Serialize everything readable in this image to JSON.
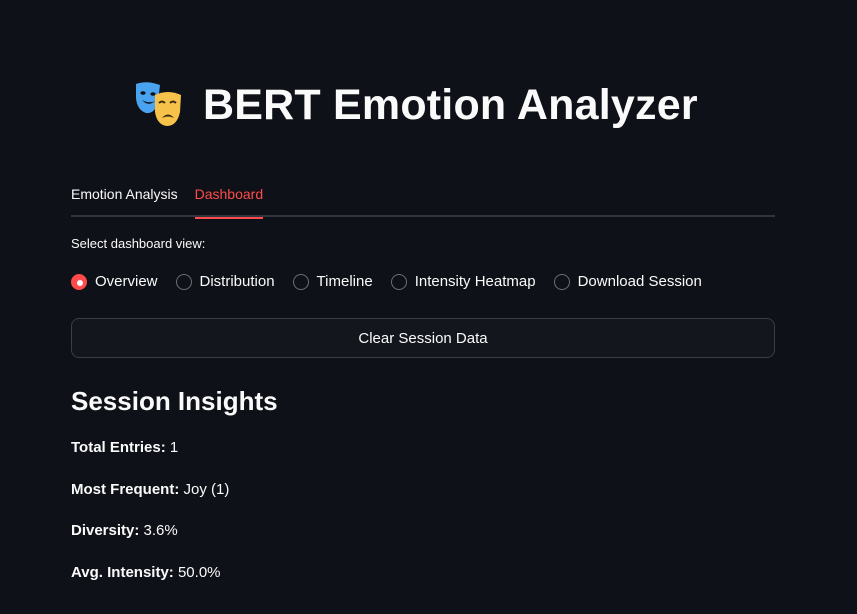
{
  "header": {
    "icon": "performing-arts-masks-icon",
    "title": "BERT Emotion Analyzer"
  },
  "tabs": [
    {
      "label": "Emotion Analysis",
      "active": false
    },
    {
      "label": "Dashboard",
      "active": true
    }
  ],
  "dashboard_view": {
    "label": "Select dashboard view:",
    "options": [
      {
        "label": "Overview",
        "selected": true
      },
      {
        "label": "Distribution",
        "selected": false
      },
      {
        "label": "Timeline",
        "selected": false
      },
      {
        "label": "Intensity Heatmap",
        "selected": false
      },
      {
        "label": "Download Session",
        "selected": false
      }
    ]
  },
  "clear_button": {
    "label": "Clear Session Data"
  },
  "insights": {
    "title": "Session Insights",
    "items": [
      {
        "label": "Total Entries:",
        "value": "1"
      },
      {
        "label": "Most Frequent:",
        "value": "Joy (1)"
      },
      {
        "label": "Diversity:",
        "value": "3.6%"
      },
      {
        "label": "Avg. Intensity:",
        "value": "50.0%"
      }
    ]
  },
  "colors": {
    "background": "#0e1117",
    "accent": "#ff4b4b",
    "text": "#fafafa"
  }
}
